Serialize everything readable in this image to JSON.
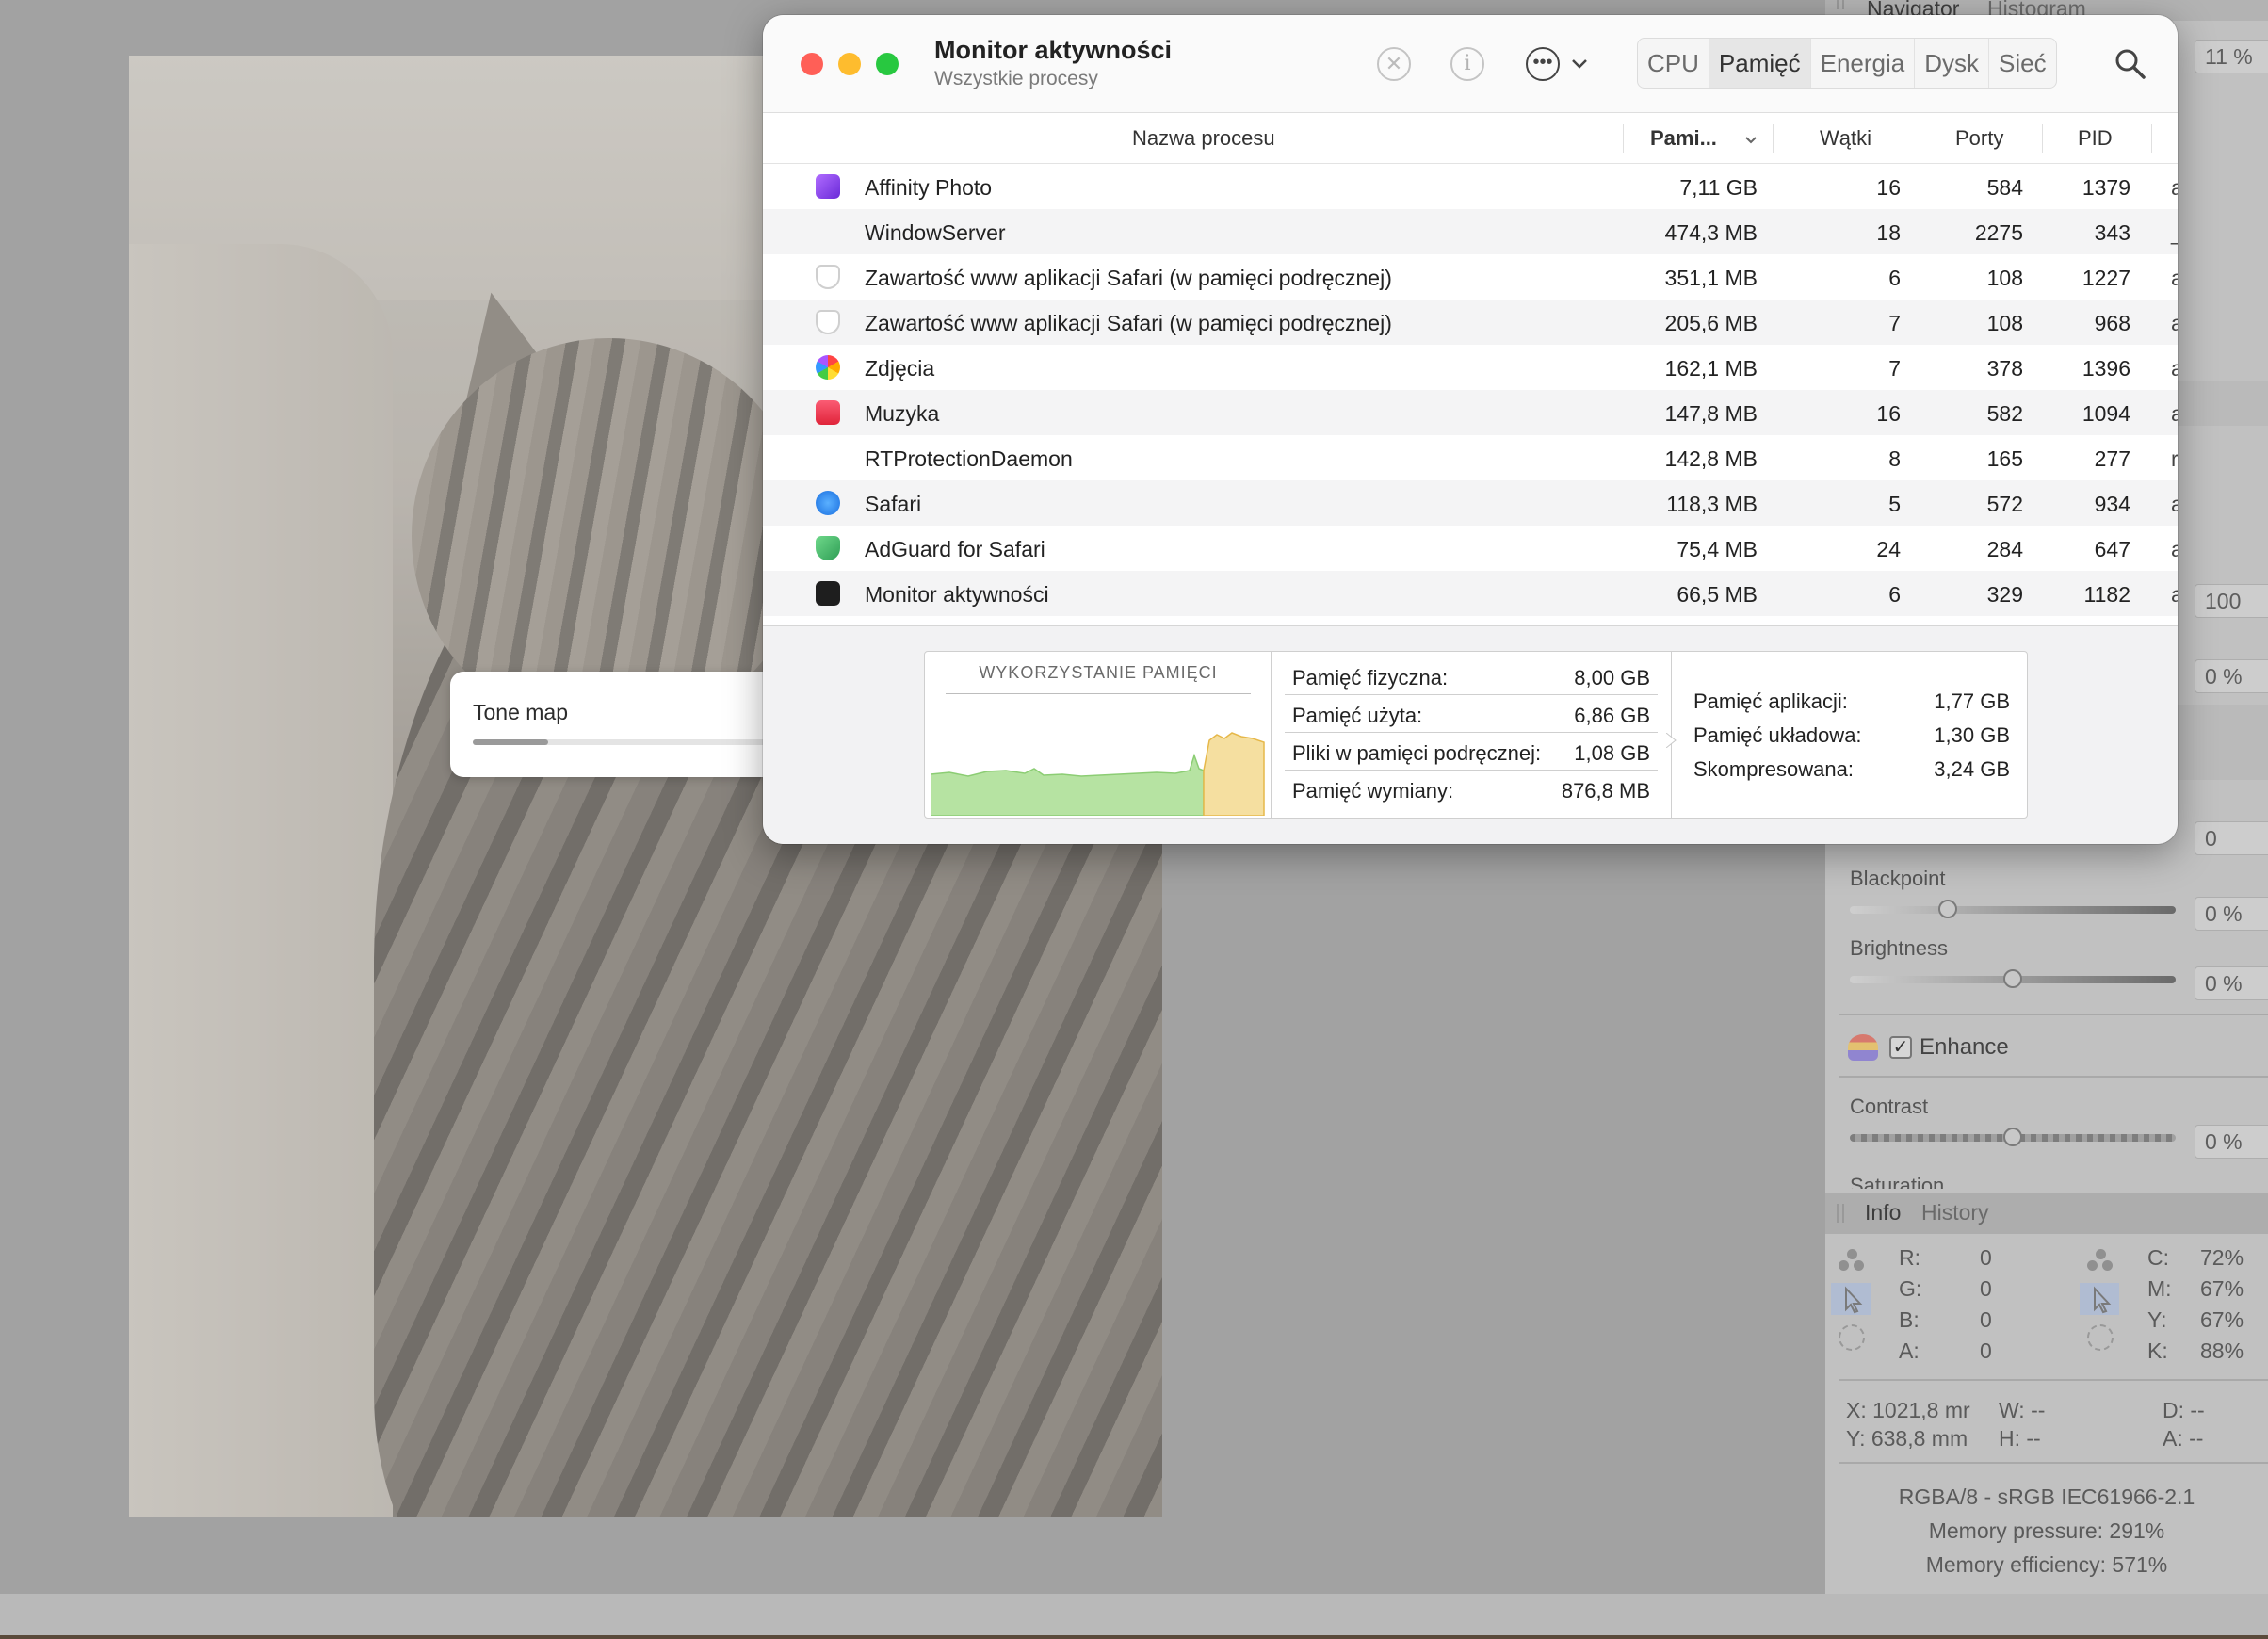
{
  "affinity": {
    "tone_map_label": "Tone map",
    "tone_map_progress": 0.25,
    "studio": {
      "tabs_top": [
        "Navigator",
        "Histogram"
      ],
      "zoom_value": "11 %",
      "value_100": "100",
      "value_0a": "0 %",
      "value_0b": "0",
      "blackpoint": {
        "label": "Blackpoint",
        "value": "0 %"
      },
      "brightness": {
        "label": "Brightness",
        "value": "0 %"
      },
      "enhance_label": "Enhance",
      "contrast": {
        "label": "Contrast",
        "value": "0 %"
      },
      "saturation_label": "Saturation",
      "tabs_bottom": [
        "Info",
        "History"
      ],
      "rgb": [
        {
          "k": "R:",
          "v": "0"
        },
        {
          "k": "G:",
          "v": "0"
        },
        {
          "k": "B:",
          "v": "0"
        },
        {
          "k": "A:",
          "v": "0"
        }
      ],
      "cmyk": [
        {
          "k": "C:",
          "v": "72%"
        },
        {
          "k": "M:",
          "v": "67%"
        },
        {
          "k": "Y:",
          "v": "67%"
        },
        {
          "k": "K:",
          "v": "88%"
        }
      ],
      "x": "X: 1021,8 mr",
      "y": "Y: 638,8 mm",
      "w": "W: --",
      "h": "H: --",
      "d": "D: --",
      "a": "A: --",
      "colorspace": "RGBA/8 - sRGB IEC61966-2.1",
      "memory_pressure": "Memory pressure: 291%",
      "memory_efficiency": "Memory efficiency: 571%"
    }
  },
  "activity_monitor": {
    "title": "Monitor aktywności",
    "subtitle": "Wszystkie procesy",
    "tabs": [
      "CPU",
      "Pamięć",
      "Energia",
      "Dysk",
      "Sieć"
    ],
    "active_tab": "Pamięć",
    "columns": {
      "name": "Nazwa procesu",
      "memory": "Pami...",
      "threads": "Wątki",
      "ports": "Porty",
      "pid": "PID"
    },
    "processes": [
      {
        "name": "Affinity Photo",
        "memory": "7,11 GB",
        "threads": "16",
        "ports": "584",
        "pid": "1379",
        "user": "a",
        "icon": "affinity-photo-icon"
      },
      {
        "name": "WindowServer",
        "memory": "474,3 MB",
        "threads": "18",
        "ports": "2275",
        "pid": "343",
        "user": "_",
        "icon": ""
      },
      {
        "name": "Zawartość www aplikacji Safari (w pamięci podręcznej)",
        "memory": "351,1 MB",
        "threads": "6",
        "ports": "108",
        "pid": "1227",
        "user": "a",
        "icon": "shield-icon"
      },
      {
        "name": "Zawartość www aplikacji Safari (w pamięci podręcznej)",
        "memory": "205,6 MB",
        "threads": "7",
        "ports": "108",
        "pid": "968",
        "user": "a",
        "icon": "shield-icon"
      },
      {
        "name": "Zdjęcia",
        "memory": "162,1 MB",
        "threads": "7",
        "ports": "378",
        "pid": "1396",
        "user": "a",
        "icon": "photos-icon"
      },
      {
        "name": "Muzyka",
        "memory": "147,8 MB",
        "threads": "16",
        "ports": "582",
        "pid": "1094",
        "user": "a",
        "icon": "music-icon"
      },
      {
        "name": "RTProtectionDaemon",
        "memory": "142,8 MB",
        "threads": "8",
        "ports": "165",
        "pid": "277",
        "user": "r",
        "icon": ""
      },
      {
        "name": "Safari",
        "memory": "118,3 MB",
        "threads": "5",
        "ports": "572",
        "pid": "934",
        "user": "a",
        "icon": "safari-icon"
      },
      {
        "name": "AdGuard for Safari",
        "memory": "75,4 MB",
        "threads": "24",
        "ports": "284",
        "pid": "647",
        "user": "a",
        "icon": "adguard-icon"
      },
      {
        "name": "Monitor aktywności",
        "memory": "66,5 MB",
        "threads": "6",
        "ports": "329",
        "pid": "1182",
        "user": "a",
        "icon": "activity-monitor-icon"
      }
    ],
    "memory_summary": {
      "graph_title": "WYKORZYSTANIE PAMIĘCI",
      "left": [
        {
          "k": "Pamięć fizyczna:",
          "v": "8,00 GB"
        },
        {
          "k": "Pamięć użyta:",
          "v": "6,86 GB"
        },
        {
          "k": "Pliki w pamięci podręcznej:",
          "v": "1,08 GB"
        },
        {
          "k": "Pamięć wymiany:",
          "v": "876,8 MB"
        }
      ],
      "right": [
        {
          "k": "Pamięć aplikacji:",
          "v": "1,77 GB"
        },
        {
          "k": "Pamięć układowa:",
          "v": "1,30 GB"
        },
        {
          "k": "Skompresowana:",
          "v": "3,24 GB"
        }
      ]
    }
  },
  "colors": {
    "close": "#ff5f57",
    "minimize": "#febc2e",
    "zoom": "#28c840",
    "graph_green": "#b6e3a2",
    "graph_yellow": "#f5dfa0"
  }
}
